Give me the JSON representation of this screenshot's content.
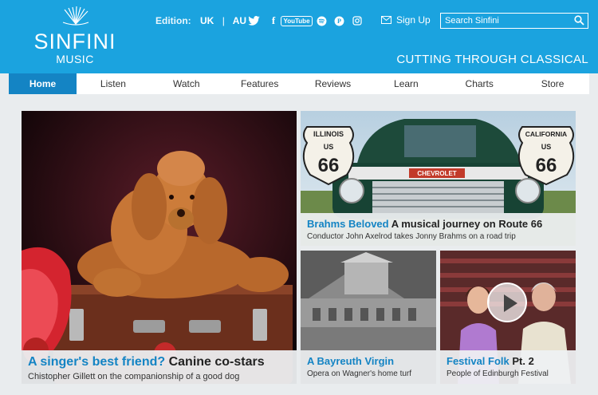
{
  "brand": {
    "name": "SINFINI",
    "sub": "MUSIC",
    "tagline": "CUTTING THROUGH CLASSICAL"
  },
  "edition": {
    "label": "Edition:",
    "options": [
      "UK",
      "AU"
    ],
    "separator": "|"
  },
  "social": [
    {
      "icon": "twitter-icon"
    },
    {
      "icon": "facebook-icon",
      "glyph": "f"
    },
    {
      "icon": "youtube-icon",
      "glyph": "YouTube"
    },
    {
      "icon": "spotify-icon"
    },
    {
      "icon": "pinterest-icon",
      "glyph": "P"
    },
    {
      "icon": "instagram-icon"
    }
  ],
  "signup": {
    "label": "Sign Up"
  },
  "search": {
    "placeholder": "Search Sinfini"
  },
  "nav": [
    "Home",
    "Listen",
    "Watch",
    "Features",
    "Reviews",
    "Learn",
    "Charts",
    "Store"
  ],
  "tiles": {
    "main": {
      "highlight": "A singer's best friend?",
      "title": "Canine co-stars",
      "subtitle": "Chistopher Gillett on the companionship of a good dog"
    },
    "route66": {
      "highlight": "Brahms Beloved",
      "title": "A musical journey on Route 66",
      "subtitle": "Conductor John Axelrod takes Jonny Brahms on a road trip",
      "signs": {
        "left_state": "ILLINOIS",
        "right_state": "CALIFORNIA",
        "us": "US",
        "number": "66"
      },
      "grille": "CHEVROLET"
    },
    "bayreuth": {
      "highlight": "A Bayreuth Virgin",
      "title": "",
      "subtitle": "Opera on Wagner's home turf"
    },
    "folk": {
      "highlight": "Festival Folk",
      "title": "Pt. 2",
      "subtitle": "People of Edinburgh Festival"
    }
  },
  "colors": {
    "header": "#1ba3df",
    "nav_active": "#1484c4",
    "accent_text": "#1484c4"
  }
}
